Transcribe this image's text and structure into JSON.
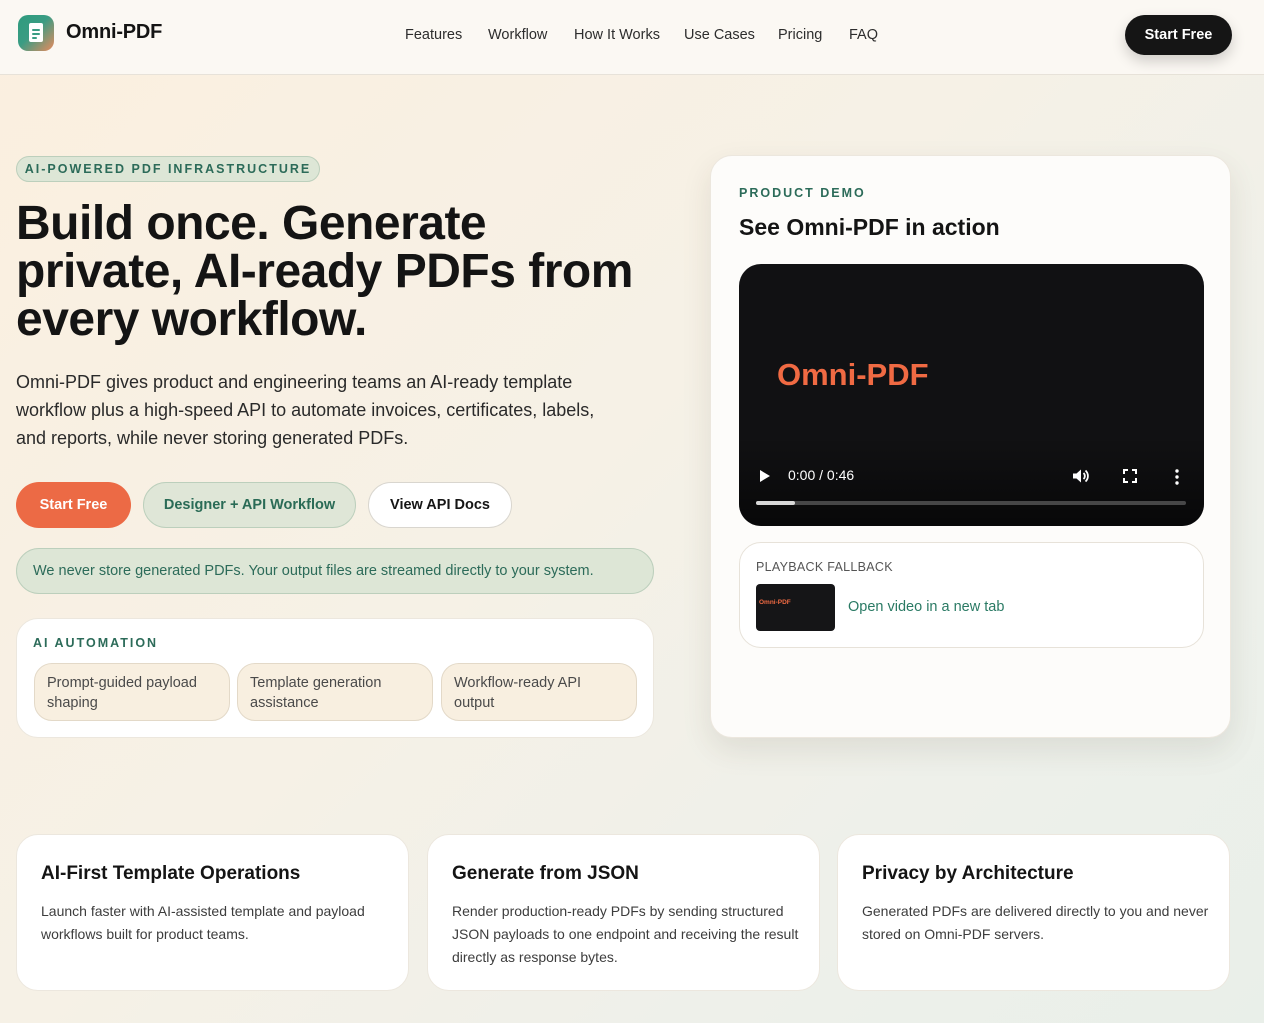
{
  "header": {
    "brand": "Omni-PDF",
    "nav": [
      "Features",
      "Workflow",
      "How It Works",
      "Use Cases",
      "Pricing",
      "FAQ"
    ],
    "cta": "Start Free"
  },
  "hero": {
    "tag": "AI-POWERED PDF INFRASTRUCTURE",
    "title": "Build once. Generate private, AI-ready PDFs from every workflow.",
    "subtitle": "Omni-PDF gives product and engineering teams an AI-ready template workflow plus a high-speed API to automate invoices, certificates, labels, and reports, while never storing generated PDFs.",
    "buttons": {
      "primary": "Start Free",
      "secondary": "Designer + API Workflow",
      "outline": "View API Docs"
    },
    "notice": "We never store generated PDFs. Your output files are streamed directly to your system."
  },
  "ai_automation": {
    "label": "AI AUTOMATION",
    "chips": [
      "Prompt-guided payload shaping",
      "Template generation assistance",
      "Workflow-ready API output"
    ]
  },
  "demo": {
    "label": "PRODUCT DEMO",
    "title": "See Omni-PDF in action",
    "video": {
      "overlay_text": "Omni-PDF",
      "time": "0:00 / 0:46",
      "progress": 0.09
    },
    "fallback": {
      "label": "PLAYBACK FALLBACK",
      "thumb_text": "Omni-PDF",
      "link": "Open video in a new tab"
    }
  },
  "features": [
    {
      "title": "AI-First Template Operations",
      "text": "Launch faster with AI-assisted template and payload workflows built for product teams."
    },
    {
      "title": "Generate from JSON",
      "text": "Render production-ready PDFs by sending structured JSON payloads to one endpoint and receiving the result directly as response bytes."
    },
    {
      "title": "Privacy by Architecture",
      "text": "Generated PDFs are delivered directly to you and never stored on Omni-PDF servers."
    }
  ],
  "colors": {
    "accent": "#ec6a45",
    "green": "#2c6b59",
    "dark": "#151515"
  }
}
